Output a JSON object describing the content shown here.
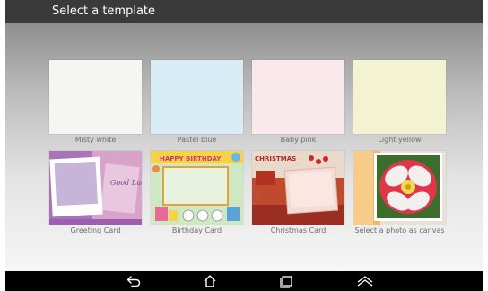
{
  "app": {
    "title": "Select a template"
  },
  "templates": [
    {
      "label": "Misty white",
      "color": "#f5f5f3"
    },
    {
      "label": "Pastel blue",
      "color": "#d8ecf6"
    },
    {
      "label": "Baby pink",
      "color": "#fae9ec"
    },
    {
      "label": "Light yellow",
      "color": "#f3f2d1"
    },
    {
      "label": "Greeting Card",
      "art": {
        "text": "Good Luck"
      }
    },
    {
      "label": "Birthday Card",
      "art": {
        "text": "HAPPY BIRTHDAY"
      }
    },
    {
      "label": "Christmas Card",
      "art": {
        "text": "CHRISTMAS"
      }
    },
    {
      "label": "Select a photo as canvas"
    }
  ],
  "navbar": {
    "icons": [
      "back-icon",
      "home-icon",
      "recent-apps-icon",
      "menu-icon"
    ]
  }
}
